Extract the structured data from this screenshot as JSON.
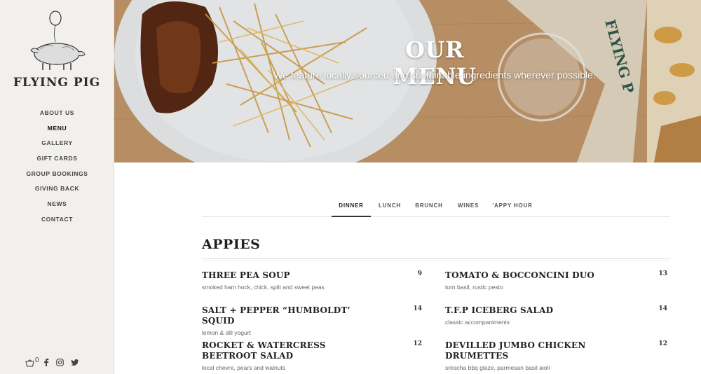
{
  "brand": {
    "name": "FLYING PIG"
  },
  "nav": {
    "items": [
      "ABOUT US",
      "MENU",
      "GALLERY",
      "GIFT CARDS",
      "GROUP BOOKINGS",
      "GIVING BACK",
      "NEWS",
      "CONTACT"
    ],
    "active": "MENU"
  },
  "social": {
    "cart_count": "0",
    "icons": [
      "cart-icon",
      "facebook-icon",
      "instagram-icon",
      "twitter-icon"
    ]
  },
  "hero": {
    "title": "OUR MENU",
    "subtitle": "We feature locally sourced and sustainable ingredients wherever possible."
  },
  "tabs": {
    "items": [
      "DINNER",
      "LUNCH",
      "BRUNCH",
      "WINES",
      "'APPY HOUR"
    ],
    "active": "DINNER"
  },
  "section": {
    "title": "APPIES",
    "items": [
      {
        "name": "THREE PEA SOUP",
        "desc": "smoked ham hock, chick, split and sweet peas",
        "price": "9"
      },
      {
        "name": "TOMATO & BOCCONCINI DUO",
        "desc": "torn basil, rustic pesto",
        "price": "13"
      },
      {
        "name": "SALT + PEPPER “HUMBOLDT’ SQUID",
        "desc": "lemon & dill yogurt",
        "price": "14"
      },
      {
        "name": "T.F.P ICEBERG SALAD",
        "desc": "classic accompaniments",
        "price": "14"
      },
      {
        "name": "ROCKET & WATERCRESS BEETROOT SALAD",
        "desc": "local chevre, pears and walnuts",
        "price": "12"
      },
      {
        "name": "DEVILLED JUMBO CHICKEN DRUMETTES",
        "desc": "sriracha bbq glaze, parmesan basil aioli",
        "price": "12"
      }
    ]
  },
  "colors": {
    "sidebar_bg": "#f1f0ec",
    "text": "#222222",
    "hero_text": "#ffffff"
  }
}
